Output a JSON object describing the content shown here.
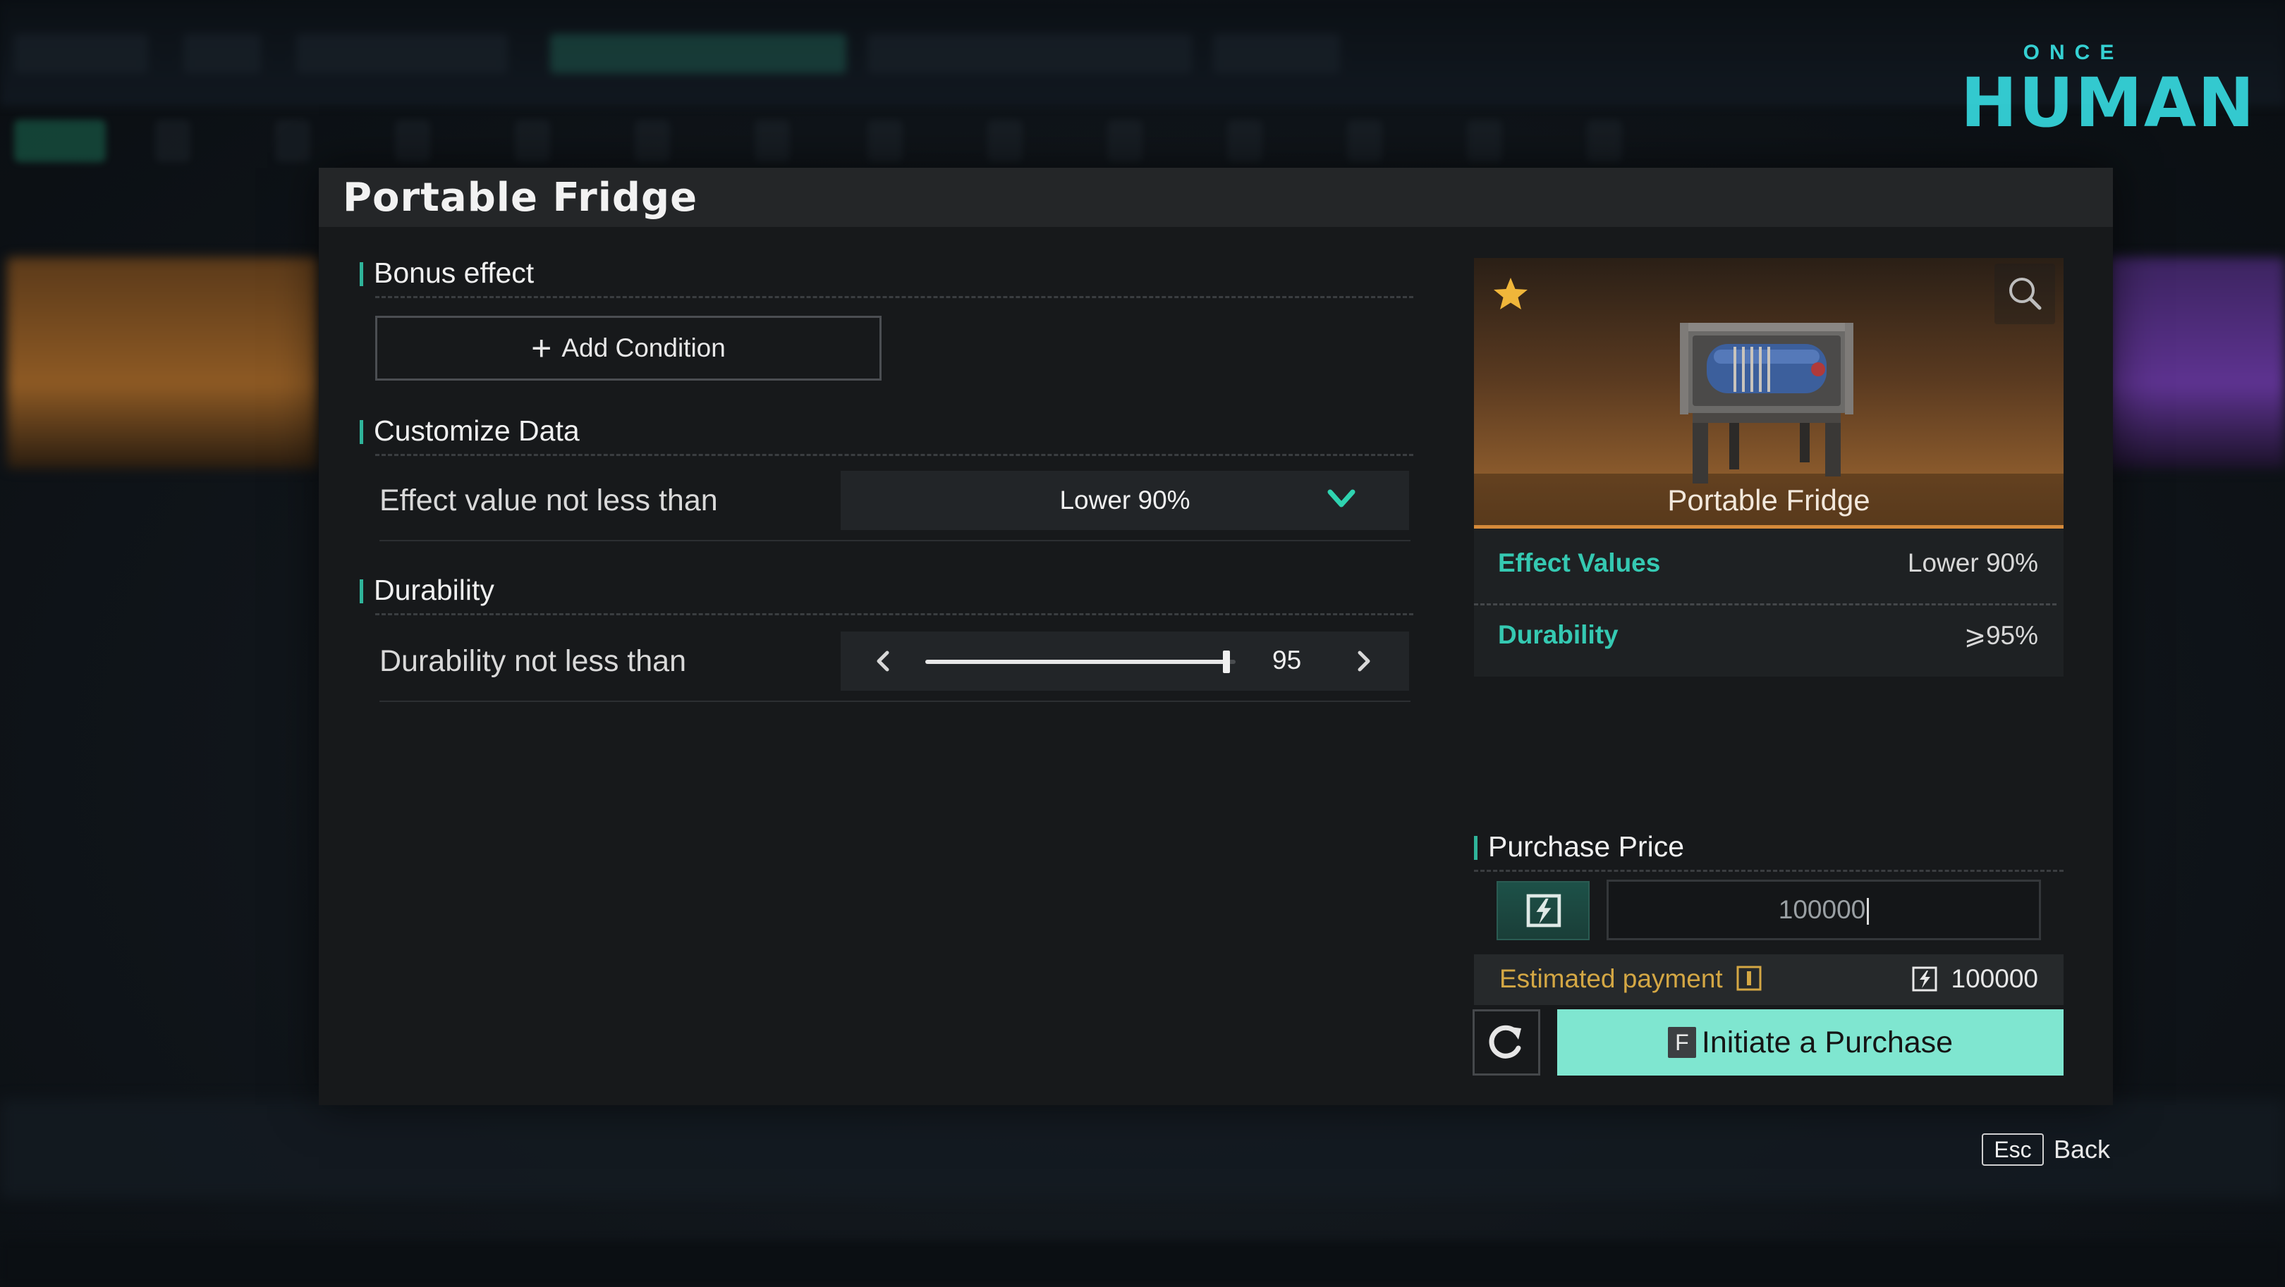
{
  "logo": {
    "top": "ONCE",
    "main": "HUMAN"
  },
  "dialog": {
    "title": "Portable Fridge",
    "bonus_effect": {
      "title": "Bonus effect",
      "add_condition_label": "Add Condition"
    },
    "customize_data": {
      "title": "Customize Data",
      "effect_label": "Effect value not less than",
      "effect_selected": "Lower 90%"
    },
    "durability": {
      "title": "Durability",
      "label": "Durability not less than",
      "value": "95",
      "slider_fraction": 0.97
    },
    "item_card": {
      "name": "Portable Fridge",
      "stats": [
        {
          "label": "Effect Values",
          "value": "Lower 90%"
        },
        {
          "label": "Durability",
          "value": "⩾95%"
        }
      ]
    },
    "purchase": {
      "title": "Purchase Price",
      "price_value": "100000",
      "estimated_label": "Estimated payment",
      "estimated_value": "100000",
      "key_hint": "F",
      "button_label": "Initiate a Purchase"
    }
  },
  "footer": {
    "esc_key": "Esc",
    "back_label": "Back"
  },
  "colors": {
    "accent": "#2fb49a",
    "stat_label": "#35c9b2",
    "purchase_button": "#7fe6d0",
    "estimated_label": "#d4a744",
    "logo": "#33c9cf"
  },
  "icons": [
    "plus-icon",
    "chevron-down-icon",
    "arrow-left-icon",
    "arrow-right-icon",
    "star-icon",
    "search-icon",
    "energy-link-icon",
    "info-icon",
    "refresh-icon"
  ]
}
